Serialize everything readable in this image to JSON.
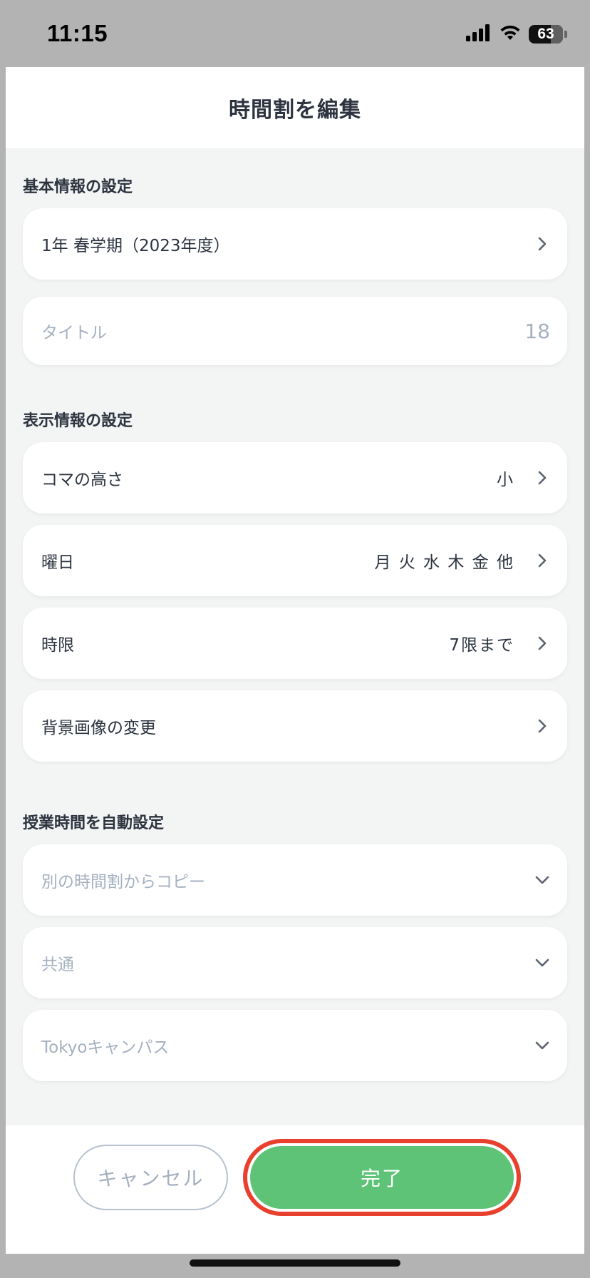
{
  "status_bar": {
    "time": "11:15",
    "battery": "63"
  },
  "header": {
    "title": "時間割を編集"
  },
  "basic_section": {
    "label": "基本情報の設定",
    "term": "1年 春学期（2023年度）",
    "title_placeholder": "タイトル",
    "title_counter": "18"
  },
  "display_section": {
    "label": "表示情報の設定",
    "rows": [
      {
        "label": "コマの高さ",
        "value": "小"
      },
      {
        "label": "曜日",
        "value": "月 火 水 木 金 他"
      },
      {
        "label": "時限",
        "value": "7限まで"
      },
      {
        "label": "背景画像の変更",
        "value": ""
      }
    ]
  },
  "auto_section": {
    "label": "授業時間を自動設定",
    "dropdowns": [
      {
        "placeholder": "別の時間割からコピー"
      },
      {
        "placeholder": "共通"
      },
      {
        "placeholder": "Tokyoキャンパス"
      }
    ]
  },
  "footer": {
    "cancel_label": "キャンセル",
    "done_label": "完了"
  },
  "colors": {
    "accent_green": "#5fc377",
    "highlight_red": "#e8402d",
    "text_primary": "#2d3440",
    "text_placeholder": "#a5b0c0"
  },
  "icons": {
    "row_chevron": "chevron-right-icon",
    "dropdown_chevron": "chevron-down-icon",
    "signal": "signal-icon",
    "wifi": "wifi-icon",
    "battery": "battery-icon"
  }
}
